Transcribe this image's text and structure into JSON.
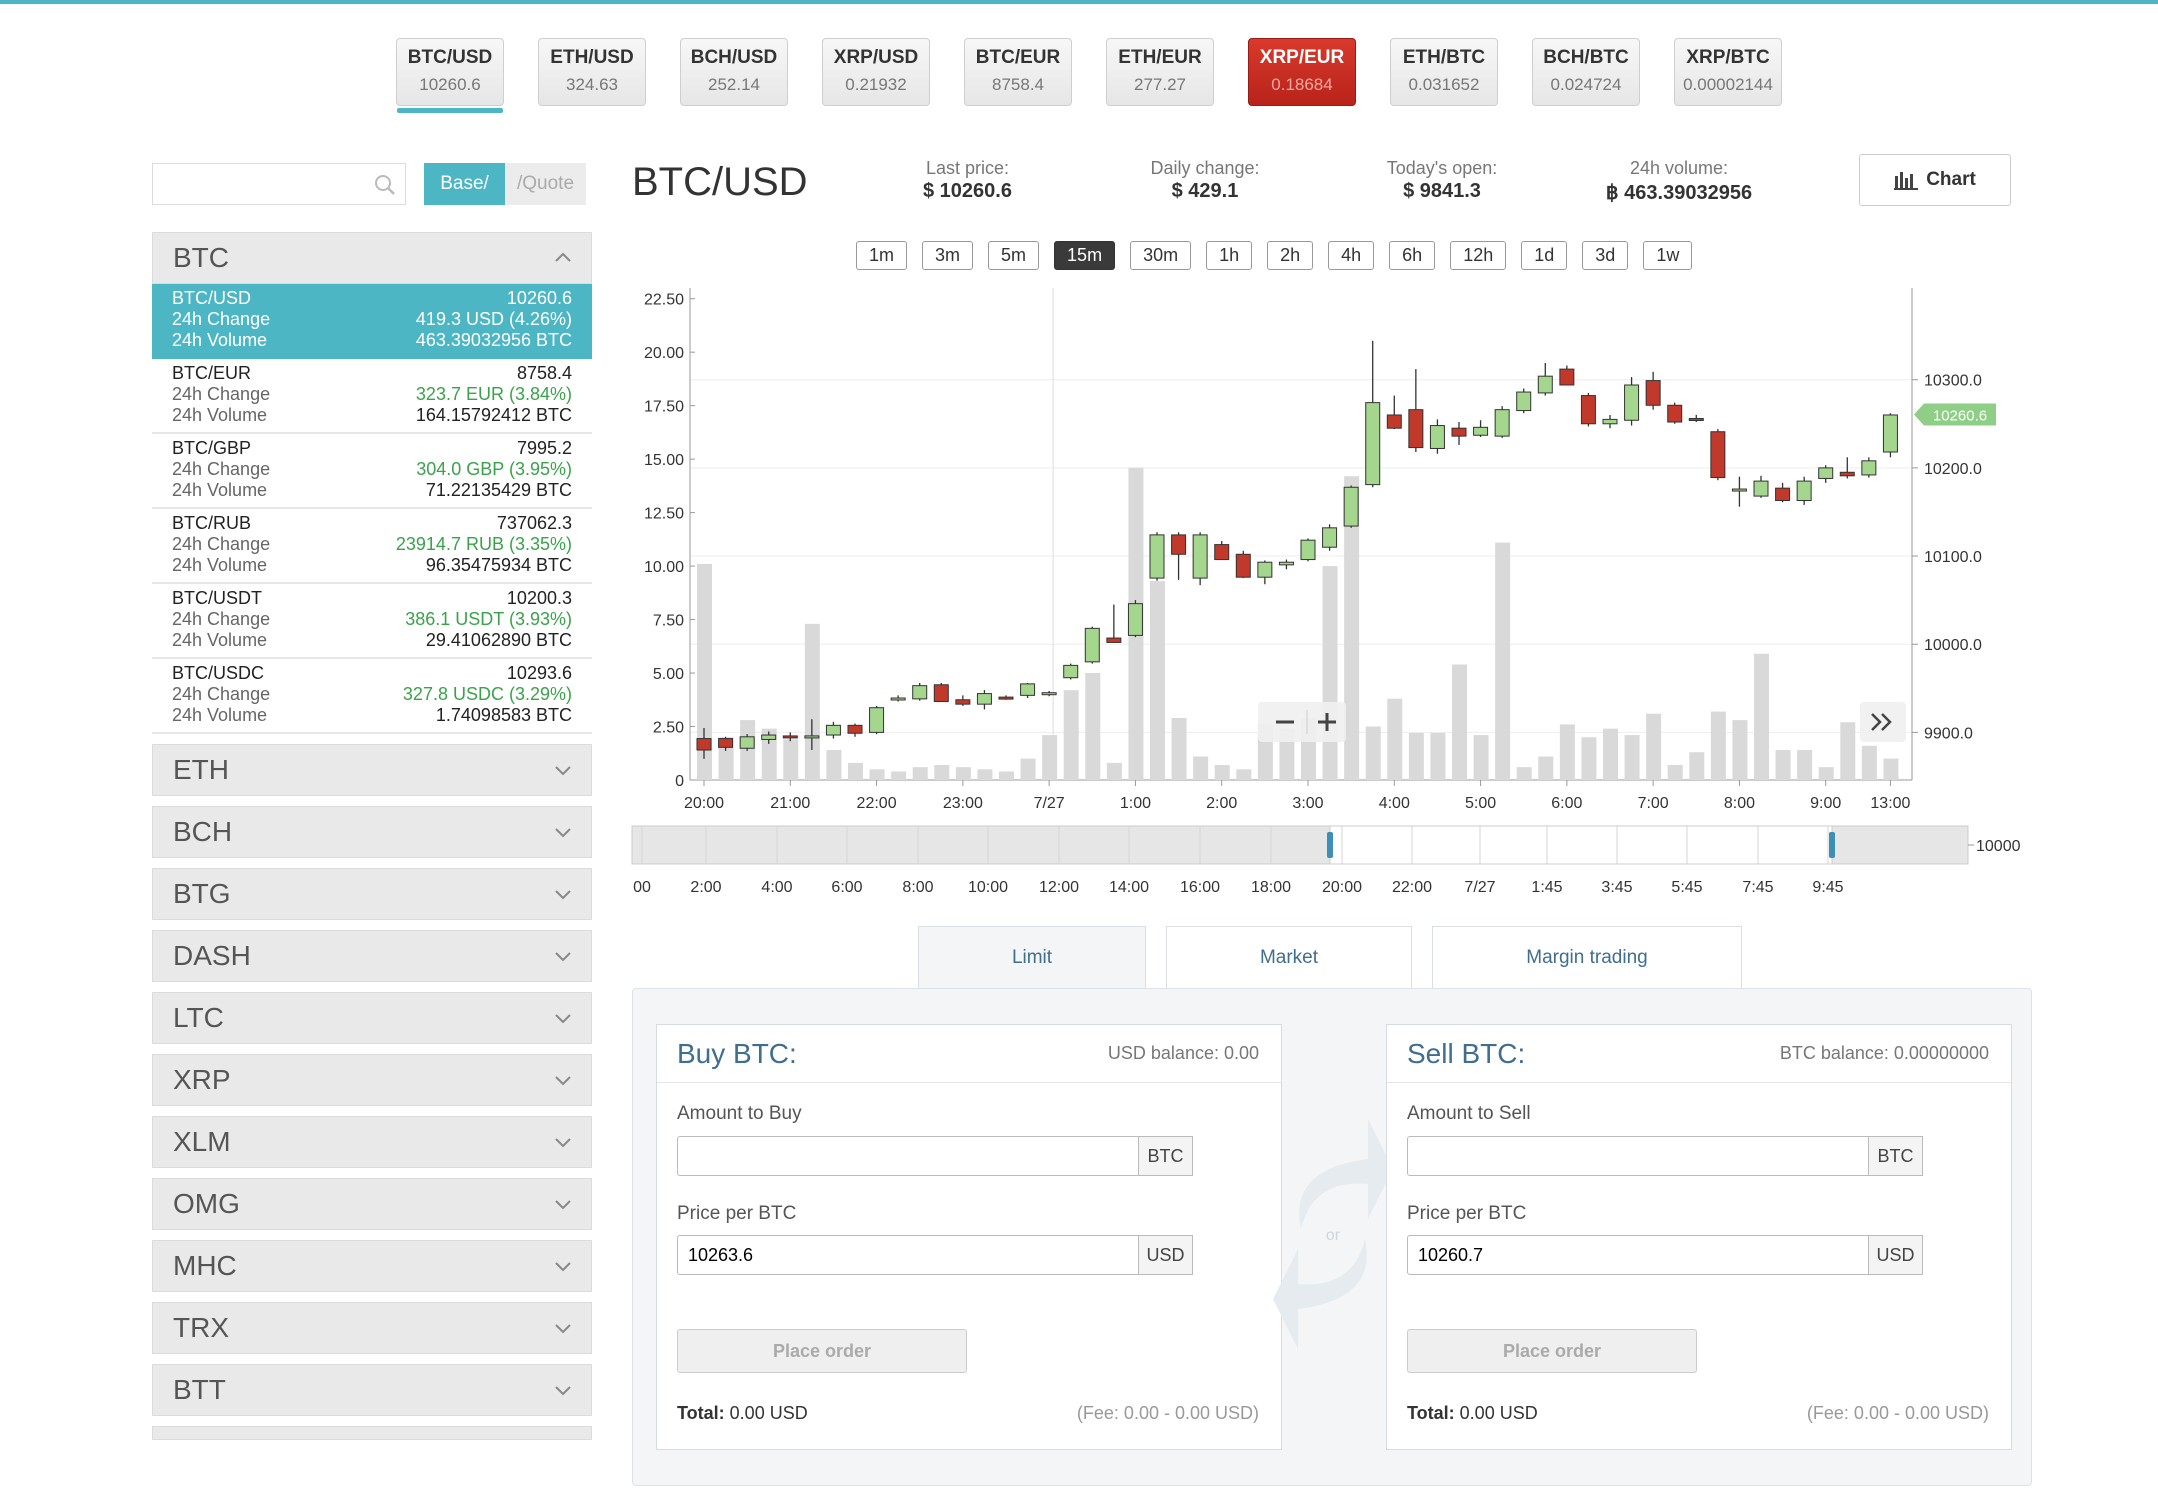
{
  "colors": {
    "accent": "#4db6c4",
    "up": "#3aa34a",
    "down": "#c0392b",
    "sell_ticker": "#c9291f"
  },
  "tickers": [
    {
      "name": "BTC/USD",
      "price": "10260.6",
      "state": "active"
    },
    {
      "name": "ETH/USD",
      "price": "324.63",
      "state": ""
    },
    {
      "name": "BCH/USD",
      "price": "252.14",
      "state": ""
    },
    {
      "name": "XRP/USD",
      "price": "0.21932",
      "state": ""
    },
    {
      "name": "BTC/EUR",
      "price": "8758.4",
      "state": ""
    },
    {
      "name": "ETH/EUR",
      "price": "277.27",
      "state": ""
    },
    {
      "name": "XRP/EUR",
      "price": "0.18684",
      "state": "red"
    },
    {
      "name": "ETH/BTC",
      "price": "0.031652",
      "state": ""
    },
    {
      "name": "BCH/BTC",
      "price": "0.024724",
      "state": ""
    },
    {
      "name": "XRP/BTC",
      "price": "0.00002144",
      "state": ""
    }
  ],
  "sidebar": {
    "search_placeholder": "",
    "search_icon": "search-icon",
    "toggle_base": "Base/",
    "toggle_quote": "/Quote",
    "btc_group": {
      "label": "BTC",
      "pairs": [
        {
          "name": "BTC/USD",
          "price": "10260.6",
          "change_label": "24h Change",
          "change": "419.3 USD (4.26%)",
          "volume_label": "24h Volume",
          "volume": "463.39032956 BTC"
        },
        {
          "name": "BTC/EUR",
          "price": "8758.4",
          "change_label": "24h Change",
          "change": "323.7 EUR (3.84%)",
          "volume_label": "24h Volume",
          "volume": "164.15792412 BTC"
        },
        {
          "name": "BTC/GBP",
          "price": "7995.2",
          "change_label": "24h Change",
          "change": "304.0 GBP (3.95%)",
          "volume_label": "24h Volume",
          "volume": "71.22135429 BTC"
        },
        {
          "name": "BTC/RUB",
          "price": "737062.3",
          "change_label": "24h Change",
          "change": "23914.7 RUB (3.35%)",
          "volume_label": "24h Volume",
          "volume": "96.35475934 BTC"
        },
        {
          "name": "BTC/USDT",
          "price": "10200.3",
          "change_label": "24h Change",
          "change": "386.1 USDT (3.93%)",
          "volume_label": "24h Volume",
          "volume": "29.41062890 BTC"
        },
        {
          "name": "BTC/USDC",
          "price": "10293.6",
          "change_label": "24h Change",
          "change": "327.8 USDC (3.29%)",
          "volume_label": "24h Volume",
          "volume": "1.74098583 BTC"
        }
      ]
    },
    "groups": [
      "ETH",
      "BCH",
      "BTG",
      "DASH",
      "LTC",
      "XRP",
      "XLM",
      "OMG",
      "MHC",
      "TRX",
      "BTT"
    ]
  },
  "market": {
    "title": "BTC/USD",
    "last_price_label": "Last price:",
    "last_price": "$ 10260.6",
    "daily_change_label": "Daily change:",
    "daily_change": "$ 429.1",
    "today_open_label": "Today's open:",
    "today_open": "$ 9841.3",
    "volume_label": "24h volume:",
    "volume": "฿ 463.39032956",
    "chart_button": "Chart"
  },
  "intervals": [
    "1m",
    "3m",
    "5m",
    "15m",
    "30m",
    "1h",
    "2h",
    "4h",
    "6h",
    "12h",
    "1d",
    "3d",
    "1w"
  ],
  "active_interval": "15m",
  "chart_data": {
    "type": "candlestick",
    "volume_axis_ticks": [
      "0",
      "2.50",
      "5.00",
      "7.50",
      "10.00",
      "12.50",
      "15.00",
      "17.50",
      "20.00",
      "22.50"
    ],
    "volume_ylim": [
      0,
      23
    ],
    "price_axis_ticks": [
      "9900.0",
      "10000.0",
      "10100.0",
      "10200.0",
      "10300.0"
    ],
    "price_ylim": [
      9846,
      10404
    ],
    "x_ticks": [
      "20:00",
      "21:00",
      "22:00",
      "23:00",
      "7/27",
      "1:00",
      "2:00",
      "3:00",
      "4:00",
      "5:00",
      "6:00",
      "7:00",
      "8:00",
      "9:00",
      "13:00"
    ],
    "last_price_label": "10260.6",
    "candles": [
      {
        "o": 9893,
        "h": 9905,
        "l": 9870,
        "c": 9880,
        "v": 10.1
      },
      {
        "o": 9893,
        "h": 9895,
        "l": 9879,
        "c": 9883,
        "v": 2.0
      },
      {
        "o": 9882,
        "h": 9898,
        "l": 9879,
        "c": 9895,
        "v": 2.8
      },
      {
        "o": 9892,
        "h": 9901,
        "l": 9887,
        "c": 9897,
        "v": 2.4
      },
      {
        "o": 9896,
        "h": 9900,
        "l": 9890,
        "c": 9894,
        "v": 1.9
      },
      {
        "o": 9894,
        "h": 9915,
        "l": 9880,
        "c": 9896,
        "v": 7.3
      },
      {
        "o": 9897,
        "h": 9912,
        "l": 9893,
        "c": 9908,
        "v": 1.4
      },
      {
        "o": 9908,
        "h": 9910,
        "l": 9895,
        "c": 9899,
        "v": 0.8
      },
      {
        "o": 9900,
        "h": 9930,
        "l": 9898,
        "c": 9928,
        "v": 0.5
      },
      {
        "o": 9937,
        "h": 9942,
        "l": 9935,
        "c": 9939,
        "v": 0.4
      },
      {
        "o": 9938,
        "h": 9956,
        "l": 9936,
        "c": 9953,
        "v": 0.6
      },
      {
        "o": 9954,
        "h": 9956,
        "l": 9935,
        "c": 9935,
        "v": 0.7
      },
      {
        "o": 9937,
        "h": 9942,
        "l": 9930,
        "c": 9932,
        "v": 0.6
      },
      {
        "o": 9932,
        "h": 9948,
        "l": 9926,
        "c": 9944,
        "v": 0.5
      },
      {
        "o": 9940,
        "h": 9942,
        "l": 9937,
        "c": 9939,
        "v": 0.4
      },
      {
        "o": 9942,
        "h": 9956,
        "l": 9939,
        "c": 9955,
        "v": 1.0
      },
      {
        "o": 9944,
        "h": 9947,
        "l": 9941,
        "c": 9945,
        "v": 2.1
      },
      {
        "o": 9962,
        "h": 9978,
        "l": 9960,
        "c": 9976,
        "v": 4.2
      },
      {
        "o": 9980,
        "h": 10020,
        "l": 9978,
        "c": 10018,
        "v": 5.0
      },
      {
        "o": 10007,
        "h": 10045,
        "l": 10002,
        "c": 10002,
        "v": 0.8
      },
      {
        "o": 10010,
        "h": 10050,
        "l": 10008,
        "c": 10046,
        "v": 14.6
      },
      {
        "o": 10075,
        "h": 10127,
        "l": 10072,
        "c": 10124,
        "v": 9.3
      },
      {
        "o": 10124,
        "h": 10127,
        "l": 10073,
        "c": 10102,
        "v": 2.9
      },
      {
        "o": 10075,
        "h": 10127,
        "l": 10067,
        "c": 10124,
        "v": 1.1
      },
      {
        "o": 10113,
        "h": 10117,
        "l": 10096,
        "c": 10096,
        "v": 0.7
      },
      {
        "o": 10102,
        "h": 10106,
        "l": 10075,
        "c": 10076,
        "v": 0.5
      },
      {
        "o": 10076,
        "h": 10095,
        "l": 10068,
        "c": 10093,
        "v": 2.6
      },
      {
        "o": 10090,
        "h": 10096,
        "l": 10085,
        "c": 10093,
        "v": 2.4
      },
      {
        "o": 10096,
        "h": 10120,
        "l": 10094,
        "c": 10118,
        "v": 2.9
      },
      {
        "o": 10110,
        "h": 10136,
        "l": 10106,
        "c": 10132,
        "v": 10.0
      },
      {
        "o": 10134,
        "h": 10180,
        "l": 10132,
        "c": 10178,
        "v": 14.2
      },
      {
        "o": 10181,
        "h": 10344,
        "l": 10178,
        "c": 10274,
        "v": 2.5
      },
      {
        "o": 10260,
        "h": 10282,
        "l": 10244,
        "c": 10245,
        "v": 3.8
      },
      {
        "o": 10266,
        "h": 10312,
        "l": 10218,
        "c": 10223,
        "v": 2.2
      },
      {
        "o": 10222,
        "h": 10255,
        "l": 10216,
        "c": 10248,
        "v": 2.2
      },
      {
        "o": 10245,
        "h": 10252,
        "l": 10226,
        "c": 10236,
        "v": 5.4
      },
      {
        "o": 10237,
        "h": 10254,
        "l": 10235,
        "c": 10246,
        "v": 2.1
      },
      {
        "o": 10236,
        "h": 10270,
        "l": 10234,
        "c": 10266,
        "v": 11.1
      },
      {
        "o": 10265,
        "h": 10290,
        "l": 10262,
        "c": 10286,
        "v": 0.6
      },
      {
        "o": 10285,
        "h": 10319,
        "l": 10282,
        "c": 10304,
        "v": 1.1
      },
      {
        "o": 10312,
        "h": 10316,
        "l": 10294,
        "c": 10294,
        "v": 2.6
      },
      {
        "o": 10282,
        "h": 10285,
        "l": 10247,
        "c": 10250,
        "v": 2.0
      },
      {
        "o": 10250,
        "h": 10260,
        "l": 10245,
        "c": 10255,
        "v": 2.4
      },
      {
        "o": 10254,
        "h": 10303,
        "l": 10248,
        "c": 10294,
        "v": 2.1
      },
      {
        "o": 10299,
        "h": 10309,
        "l": 10266,
        "c": 10271,
        "v": 3.1
      },
      {
        "o": 10271,
        "h": 10274,
        "l": 10250,
        "c": 10252,
        "v": 0.7
      },
      {
        "o": 10256,
        "h": 10260,
        "l": 10252,
        "c": 10254,
        "v": 1.3
      },
      {
        "o": 10241,
        "h": 10244,
        "l": 10186,
        "c": 10189,
        "v": 3.2
      },
      {
        "o": 10176,
        "h": 10190,
        "l": 10156,
        "c": 10176,
        "v": 2.8
      },
      {
        "o": 10168,
        "h": 10191,
        "l": 10166,
        "c": 10185,
        "v": 5.9
      },
      {
        "o": 10177,
        "h": 10183,
        "l": 10161,
        "c": 10163,
        "v": 1.4
      },
      {
        "o": 10163,
        "h": 10190,
        "l": 10158,
        "c": 10185,
        "v": 1.4
      },
      {
        "o": 10188,
        "h": 10203,
        "l": 10183,
        "c": 10200,
        "v": 0.6
      },
      {
        "o": 10195,
        "h": 10212,
        "l": 10188,
        "c": 10191,
        "v": 2.7
      },
      {
        "o": 10192,
        "h": 10212,
        "l": 10189,
        "c": 10208,
        "v": 1.6
      },
      {
        "o": 10218,
        "h": 10262,
        "l": 10212,
        "c": 10260,
        "v": 1.0
      }
    ],
    "navigator_ticks": [
      "00",
      "2:00",
      "4:00",
      "6:00",
      "8:00",
      "10:00",
      "12:00",
      "14:00",
      "16:00",
      "18:00",
      "20:00",
      "22:00",
      "7/27",
      "1:45",
      "3:45",
      "5:45",
      "7:45",
      "9:45"
    ],
    "navigator_value": "10000"
  },
  "order_tabs": [
    "Limit",
    "Market",
    "Margin trading"
  ],
  "active_order_tab": "Limit",
  "buy": {
    "title": "Buy BTC:",
    "balance": "USD balance: 0.00",
    "amount_label": "Amount to Buy",
    "amount_value": "",
    "amount_unit": "BTC",
    "price_label": "Price per BTC",
    "price_value": "10263.6",
    "price_unit": "USD",
    "button": "Place order",
    "total_label": "Total:",
    "total_value": "0.00 USD",
    "fee": "(Fee: 0.00 - 0.00 USD)"
  },
  "sell": {
    "title": "Sell BTC:",
    "balance": "BTC balance: 0.00000000",
    "amount_label": "Amount to Sell",
    "amount_value": "",
    "amount_unit": "BTC",
    "price_label": "Price per BTC",
    "price_value": "10260.7",
    "price_unit": "USD",
    "button": "Place order",
    "total_label": "Total:",
    "total_value": "0.00 USD",
    "fee": "(Fee: 0.00 - 0.00 USD)"
  },
  "swap_label": "or"
}
